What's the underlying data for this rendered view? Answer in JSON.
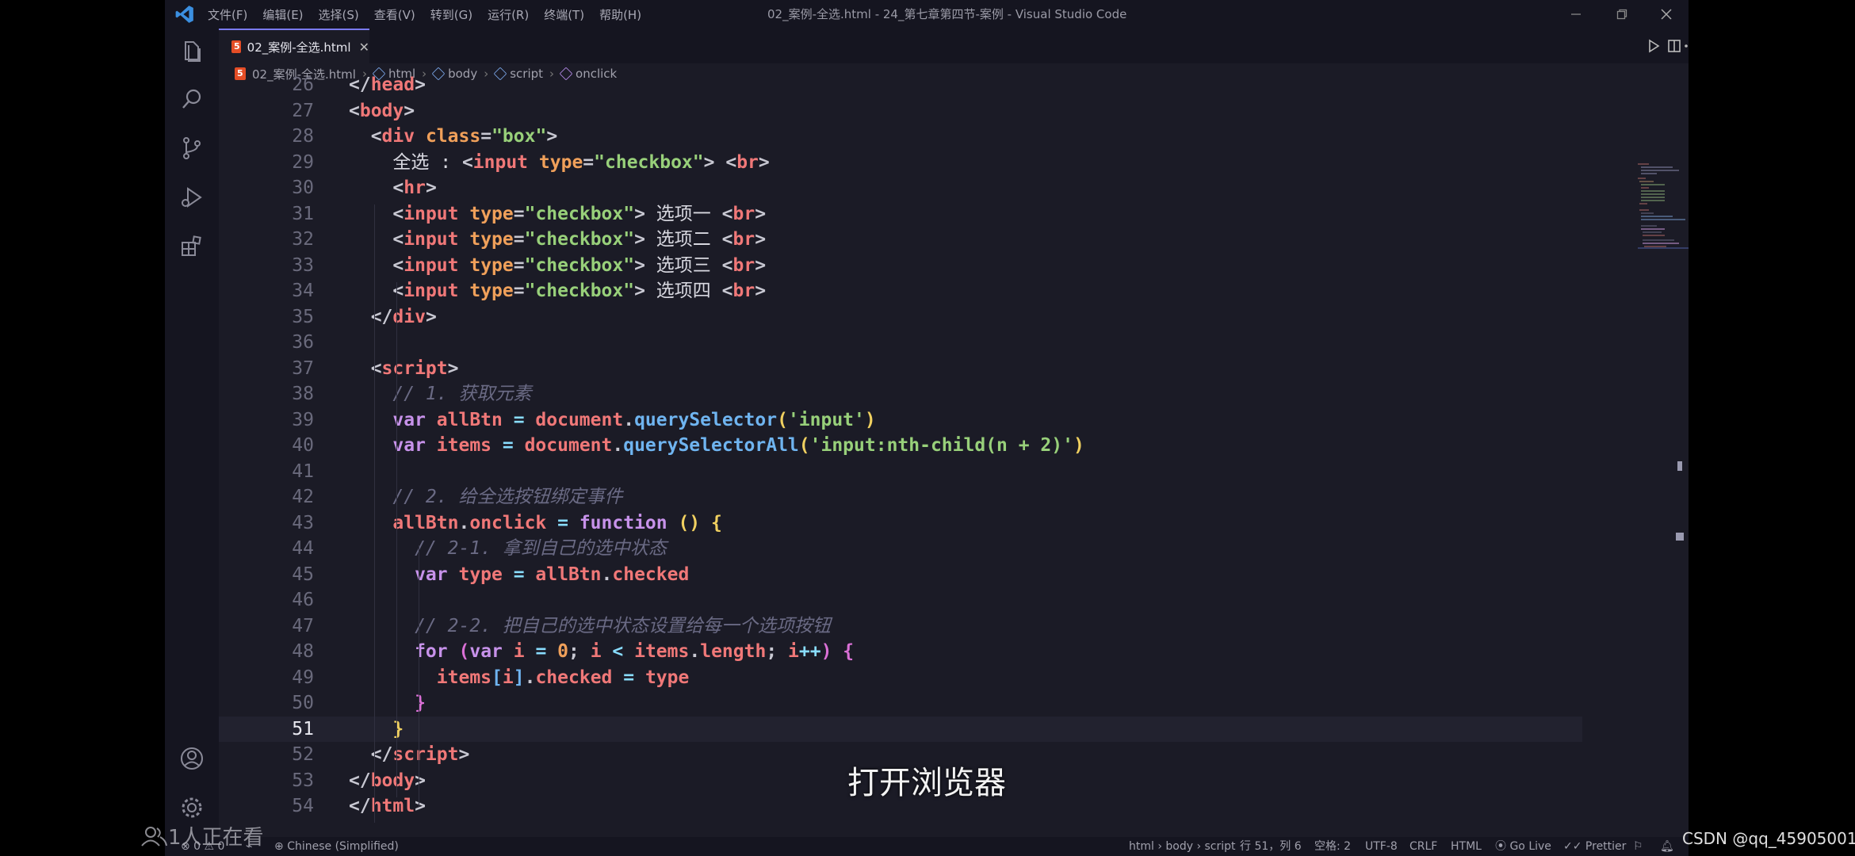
{
  "menu": [
    "文件(F)",
    "编辑(E)",
    "选择(S)",
    "查看(V)",
    "转到(G)",
    "运行(R)",
    "终端(T)",
    "帮助(H)"
  ],
  "window_title": "02_案例-全选.html - 24_第七章第四节-案例 - Visual Studio Code",
  "tab": {
    "label": "02_案例-全选.html",
    "close": "✕"
  },
  "breadcrumb": [
    "02_案例-全选.html",
    "html",
    "body",
    "script",
    "onclick"
  ],
  "code_lines": [
    {
      "no": "26",
      "tokens": [
        [
          "t-punc",
          "</"
        ],
        [
          "t-tag",
          "head"
        ],
        [
          "t-punc",
          ">"
        ]
      ]
    },
    {
      "no": "27",
      "tokens": [
        [
          "t-punc",
          "<"
        ],
        [
          "t-tag",
          "body"
        ],
        [
          "t-punc",
          ">"
        ]
      ]
    },
    {
      "no": "28",
      "tokens": [
        [
          "t-punc",
          "  <"
        ],
        [
          "t-tag",
          "div"
        ],
        [
          "t-punc",
          " "
        ],
        [
          "t-attr",
          "class"
        ],
        [
          "t-punc",
          "="
        ],
        [
          "t-str",
          "\"box\""
        ],
        [
          "t-punc",
          ">"
        ]
      ]
    },
    {
      "no": "29",
      "tokens": [
        [
          "t-text",
          "    全选 : "
        ],
        [
          "t-punc",
          "<"
        ],
        [
          "t-tag",
          "input"
        ],
        [
          "t-punc",
          " "
        ],
        [
          "t-attr",
          "type"
        ],
        [
          "t-punc",
          "="
        ],
        [
          "t-str",
          "\"checkbox\""
        ],
        [
          "t-punc",
          "> <"
        ],
        [
          "t-tag",
          "br"
        ],
        [
          "t-punc",
          ">"
        ]
      ]
    },
    {
      "no": "30",
      "tokens": [
        [
          "t-punc",
          "    <"
        ],
        [
          "t-tag",
          "hr"
        ],
        [
          "t-punc",
          ">"
        ]
      ]
    },
    {
      "no": "31",
      "tokens": [
        [
          "t-punc",
          "    <"
        ],
        [
          "t-tag",
          "input"
        ],
        [
          "t-punc",
          " "
        ],
        [
          "t-attr",
          "type"
        ],
        [
          "t-punc",
          "="
        ],
        [
          "t-str",
          "\"checkbox\""
        ],
        [
          "t-punc",
          ">"
        ],
        [
          "t-text",
          " 选项一 "
        ],
        [
          "t-punc",
          "<"
        ],
        [
          "t-tag",
          "br"
        ],
        [
          "t-punc",
          ">"
        ]
      ]
    },
    {
      "no": "32",
      "tokens": [
        [
          "t-punc",
          "    <"
        ],
        [
          "t-tag",
          "input"
        ],
        [
          "t-punc",
          " "
        ],
        [
          "t-attr",
          "type"
        ],
        [
          "t-punc",
          "="
        ],
        [
          "t-str",
          "\"checkbox\""
        ],
        [
          "t-punc",
          ">"
        ],
        [
          "t-text",
          " 选项二 "
        ],
        [
          "t-punc",
          "<"
        ],
        [
          "t-tag",
          "br"
        ],
        [
          "t-punc",
          ">"
        ]
      ]
    },
    {
      "no": "33",
      "tokens": [
        [
          "t-punc",
          "    <"
        ],
        [
          "t-tag",
          "input"
        ],
        [
          "t-punc",
          " "
        ],
        [
          "t-attr",
          "type"
        ],
        [
          "t-punc",
          "="
        ],
        [
          "t-str",
          "\"checkbox\""
        ],
        [
          "t-punc",
          ">"
        ],
        [
          "t-text",
          " 选项三 "
        ],
        [
          "t-punc",
          "<"
        ],
        [
          "t-tag",
          "br"
        ],
        [
          "t-punc",
          ">"
        ]
      ]
    },
    {
      "no": "34",
      "tokens": [
        [
          "t-punc",
          "    <"
        ],
        [
          "t-tag",
          "input"
        ],
        [
          "t-punc",
          " "
        ],
        [
          "t-attr",
          "type"
        ],
        [
          "t-punc",
          "="
        ],
        [
          "t-str",
          "\"checkbox\""
        ],
        [
          "t-punc",
          ">"
        ],
        [
          "t-text",
          " 选项四 "
        ],
        [
          "t-punc",
          "<"
        ],
        [
          "t-tag",
          "br"
        ],
        [
          "t-punc",
          ">"
        ]
      ]
    },
    {
      "no": "35",
      "tokens": [
        [
          "t-punc",
          "  </"
        ],
        [
          "t-tag",
          "div"
        ],
        [
          "t-punc",
          ">"
        ]
      ]
    },
    {
      "no": "36",
      "tokens": []
    },
    {
      "no": "37",
      "tokens": [
        [
          "t-punc",
          "  <"
        ],
        [
          "t-tag",
          "script"
        ],
        [
          "t-punc",
          ">"
        ]
      ]
    },
    {
      "no": "38",
      "tokens": [
        [
          "t-cmt",
          "    // 1. 获取元素"
        ]
      ]
    },
    {
      "no": "39",
      "tokens": [
        [
          "t-kw",
          "    var "
        ],
        [
          "t-var",
          "allBtn"
        ],
        [
          "t-op",
          " = "
        ],
        [
          "t-var",
          "document"
        ],
        [
          "t-punc",
          "."
        ],
        [
          "t-fn",
          "querySelector"
        ],
        [
          "t-brace",
          "("
        ],
        [
          "t-str",
          "'input'"
        ],
        [
          "t-brace",
          ")"
        ]
      ]
    },
    {
      "no": "40",
      "tokens": [
        [
          "t-kw",
          "    var "
        ],
        [
          "t-var",
          "items"
        ],
        [
          "t-op",
          " = "
        ],
        [
          "t-var",
          "document"
        ],
        [
          "t-punc",
          "."
        ],
        [
          "t-fn",
          "querySelectorAll"
        ],
        [
          "t-brace",
          "("
        ],
        [
          "t-str",
          "'input:nth-child(n + 2)'"
        ],
        [
          "t-brace",
          ")"
        ]
      ]
    },
    {
      "no": "41",
      "tokens": []
    },
    {
      "no": "42",
      "tokens": [
        [
          "t-cmt",
          "    // 2. 给全选按钮绑定事件"
        ]
      ]
    },
    {
      "no": "43",
      "tokens": [
        [
          "t-var",
          "    allBtn"
        ],
        [
          "t-punc",
          "."
        ],
        [
          "t-var",
          "onclick"
        ],
        [
          "t-op",
          " = "
        ],
        [
          "t-kw",
          "function "
        ],
        [
          "t-brace",
          "() {"
        ]
      ]
    },
    {
      "no": "44",
      "tokens": [
        [
          "t-cmt",
          "      // 2-1. 拿到自己的选中状态"
        ]
      ]
    },
    {
      "no": "45",
      "tokens": [
        [
          "t-kw",
          "      var "
        ],
        [
          "t-var",
          "type"
        ],
        [
          "t-op",
          " = "
        ],
        [
          "t-var",
          "allBtn"
        ],
        [
          "t-punc",
          "."
        ],
        [
          "t-var",
          "checked"
        ]
      ]
    },
    {
      "no": "46",
      "tokens": []
    },
    {
      "no": "47",
      "tokens": [
        [
          "t-cmt",
          "      // 2-2. 把自己的选中状态设置给每一个选项按钮"
        ]
      ]
    },
    {
      "no": "48",
      "tokens": [
        [
          "t-kw",
          "      for "
        ],
        [
          "t-brace2",
          "("
        ],
        [
          "t-kw",
          "var "
        ],
        [
          "t-var",
          "i"
        ],
        [
          "t-op",
          " = "
        ],
        [
          "t-num",
          "0"
        ],
        [
          "t-punc",
          "; "
        ],
        [
          "t-var",
          "i"
        ],
        [
          "t-op",
          " < "
        ],
        [
          "t-var",
          "items"
        ],
        [
          "t-punc",
          "."
        ],
        [
          "t-var",
          "length"
        ],
        [
          "t-punc",
          "; "
        ],
        [
          "t-var",
          "i"
        ],
        [
          "t-op",
          "++"
        ],
        [
          "t-brace2",
          ") {"
        ]
      ]
    },
    {
      "no": "49",
      "tokens": [
        [
          "t-var",
          "        items"
        ],
        [
          "t-fn",
          "["
        ],
        [
          "t-var",
          "i"
        ],
        [
          "t-fn",
          "]"
        ],
        [
          "t-punc",
          "."
        ],
        [
          "t-var",
          "checked"
        ],
        [
          "t-op",
          " = "
        ],
        [
          "t-var",
          "type"
        ]
      ]
    },
    {
      "no": "50",
      "tokens": [
        [
          "t-brace2",
          "      }"
        ]
      ]
    },
    {
      "no": "51",
      "tokens": [
        [
          "t-brace",
          "    }"
        ]
      ],
      "current": true
    },
    {
      "no": "52",
      "tokens": [
        [
          "t-punc",
          "  </"
        ],
        [
          "t-tag",
          "script"
        ],
        [
          "t-punc",
          ">"
        ]
      ]
    },
    {
      "no": "53",
      "tokens": [
        [
          "t-punc",
          "</"
        ],
        [
          "t-tag",
          "body"
        ],
        [
          "t-punc",
          ">"
        ]
      ]
    },
    {
      "no": "54",
      "tokens": [
        [
          "t-punc",
          "</"
        ],
        [
          "t-tag",
          "html"
        ],
        [
          "t-punc",
          ">"
        ]
      ]
    }
  ],
  "subtitle": "打开浏览器",
  "status": {
    "problems": "⊗ 0 ⚠ 0",
    "language_pack": "Chinese (Simplified)",
    "path": "html › body › script",
    "position": "行 51，列 6",
    "spaces": "空格: 2",
    "encoding": "UTF-8",
    "eol": "CRLF",
    "language": "HTML",
    "golive": "Go Live",
    "prettier": "Prettier"
  },
  "overlay": {
    "viewers": "1人正在看",
    "watermark": "CSDN @qq_45905001"
  },
  "colors": {
    "tab_accent": "#7a7af0",
    "editor_bg": "#1b1b26"
  }
}
